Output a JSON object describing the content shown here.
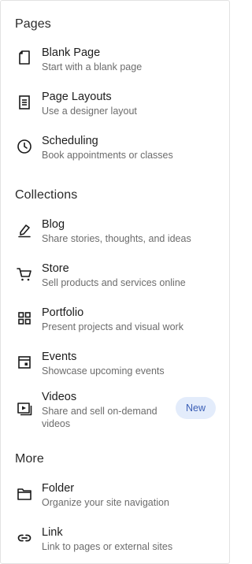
{
  "sections": {
    "pages": {
      "title": "Pages",
      "items": [
        {
          "title": "Blank Page",
          "subtitle": "Start with a blank page",
          "icon": "blank-page-icon"
        },
        {
          "title": "Page Layouts",
          "subtitle": "Use a designer layout",
          "icon": "page-layouts-icon"
        },
        {
          "title": "Scheduling",
          "subtitle": "Book appointments or classes",
          "icon": "clock-icon"
        }
      ]
    },
    "collections": {
      "title": "Collections",
      "items": [
        {
          "title": "Blog",
          "subtitle": "Share stories, thoughts, and ideas",
          "icon": "blog-pen-icon"
        },
        {
          "title": "Store",
          "subtitle": "Sell products and services online",
          "icon": "cart-icon"
        },
        {
          "title": "Portfolio",
          "subtitle": "Present projects and visual work",
          "icon": "grid-icon"
        },
        {
          "title": "Events",
          "subtitle": "Showcase upcoming events",
          "icon": "calendar-icon"
        },
        {
          "title": "Videos",
          "subtitle": "Share and sell on-demand videos",
          "icon": "video-icon",
          "badge": "New"
        }
      ]
    },
    "more": {
      "title": "More",
      "items": [
        {
          "title": "Folder",
          "subtitle": "Organize your site navigation",
          "icon": "folder-icon"
        },
        {
          "title": "Link",
          "subtitle": "Link to pages or external sites",
          "icon": "link-icon"
        }
      ]
    }
  },
  "colors": {
    "badge_bg": "#e3ecfb",
    "badge_text": "#3b5fb6",
    "subtitle": "#6c6c6c"
  }
}
